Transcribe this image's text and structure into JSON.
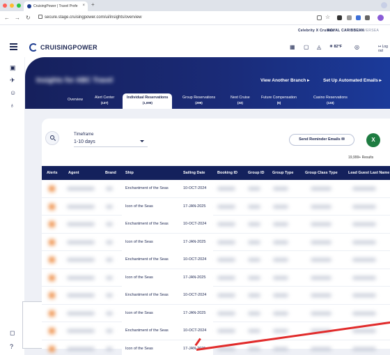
{
  "browser": {
    "tab_title": "CruisingPower | Travel Profe",
    "url": "secure.stage.cruisingpower.com/ui/insights/overview"
  },
  "brands": {
    "celebrity": "Celebrity X Cruises",
    "royal": "ROYAL CARIBBEAN",
    "silversea": "SILVERSEA"
  },
  "header": {
    "logo": "CRUISINGPOWER",
    "weather": "82°F",
    "logout": "Log out"
  },
  "hero": {
    "title": "Insights for ABC Travel",
    "view_branch": "View Another Branch",
    "automated_emails": "Set Up Automated Emails"
  },
  "tabs": [
    {
      "label": "Overview",
      "count": ""
    },
    {
      "label": "Alert Center",
      "count": "(137)"
    },
    {
      "label": "Individual Reservations",
      "count": "(1,698)"
    },
    {
      "label": "Group Reservations",
      "count": "(299)"
    },
    {
      "label": "Next Cruise",
      "count": "(33)"
    },
    {
      "label": "Future Compensation",
      "count": "(6)"
    },
    {
      "label": "Casino Reservations",
      "count": "(133)"
    }
  ],
  "filters": {
    "timeframe_label": "Timeframe",
    "timeframe_value": "1-10 days",
    "reminder_button": "Send Reminder Emails",
    "excel_label": "X",
    "results": "19,999+ Results"
  },
  "table": {
    "columns": [
      "Alerts",
      "Agent",
      "Brand",
      "Ship",
      "Sailing Date",
      "Booking ID",
      "Group ID",
      "Group Type",
      "Group Class Type",
      "Lead Guest Last Name"
    ],
    "rows": [
      {
        "ship": "Enchantment of the Seas",
        "date": "10-OCT-2024"
      },
      {
        "ship": "Icon of the Seas",
        "date": "17-JAN-2025"
      },
      {
        "ship": "Enchantment of the Seas",
        "date": "10-OCT-2024"
      },
      {
        "ship": "Icon of the Seas",
        "date": "17-JAN-2025"
      },
      {
        "ship": "Enchantment of the Seas",
        "date": "10-OCT-2024"
      },
      {
        "ship": "Icon of the Seas",
        "date": "17-JAN-2025"
      },
      {
        "ship": "Enchantment of the Seas",
        "date": "10-OCT-2024"
      },
      {
        "ship": "Icon of the Seas",
        "date": "17-JAN-2025"
      },
      {
        "ship": "Enchantment of the Seas",
        "date": "10-OCT-2024"
      },
      {
        "ship": "Icon of the Seas",
        "date": "17-JAN-2025"
      }
    ]
  },
  "colors": {
    "navy": "#14215c",
    "hero_end": "#1b3a9a",
    "excel_green": "#1e7c41",
    "arrow_red": "#e12b2b"
  }
}
